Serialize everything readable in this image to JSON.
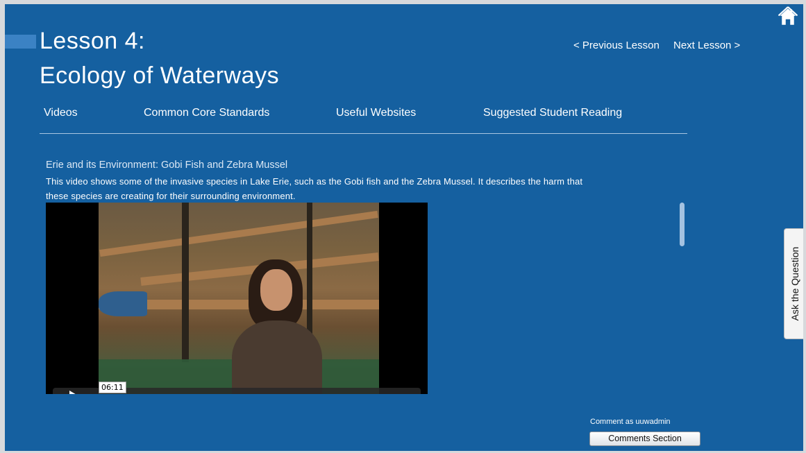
{
  "header": {
    "title_line1": "Lesson 4:",
    "title_line2": "Ecology of Waterways",
    "previous_label": "< Previous Lesson",
    "next_label": "Next Lesson >"
  },
  "tabs": [
    {
      "label": "Videos"
    },
    {
      "label": "Common Core Standards"
    },
    {
      "label": "Useful Websites"
    },
    {
      "label": "Suggested Student Reading"
    }
  ],
  "video": {
    "title": "Erie and its Environment: Gobi Fish and Zebra Mussel",
    "description": "This video shows some of the invasive species in Lake Erie, such as the Gobi fish and the Zebra Mussel. It describes the harm that these species are creating for their surrounding environment.",
    "duration": "06:11"
  },
  "side_tab": {
    "label": "Ask the Question"
  },
  "comments": {
    "comment_as": "Comment as uuwadmin",
    "button_label": "Comments Section"
  },
  "colors": {
    "background": "#1560a0",
    "accent": "#3b82c4"
  }
}
